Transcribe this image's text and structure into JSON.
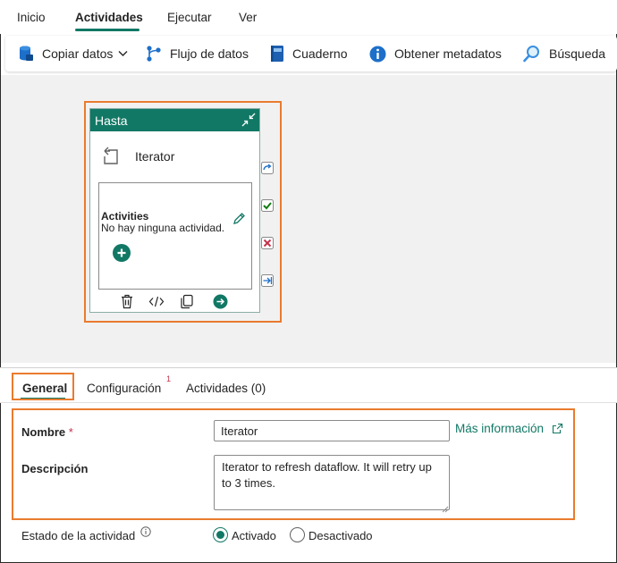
{
  "menu_tabs": [
    {
      "label": "Inicio"
    },
    {
      "label": "Actividades"
    },
    {
      "label": "Ejecutar"
    },
    {
      "label": "Ver"
    }
  ],
  "toolbar": {
    "copy_data": "Copiar datos",
    "dataflow": "Flujo de datos",
    "notebook": "Cuaderno",
    "get_metadata": "Obtener metadatos",
    "lookup": "Búsqueda"
  },
  "activity_card": {
    "header": "Hasta",
    "name": "Iterator",
    "activities_title": "Activities",
    "activities_empty": "No hay ninguna actividad."
  },
  "properties": {
    "tabs": [
      {
        "label": "General"
      },
      {
        "label": "Configuración"
      },
      {
        "label": "Actividades (0)"
      }
    ],
    "config_badge": "1",
    "name_label": "Nombre",
    "required_mark": "*",
    "name_value": "Iterator",
    "more_info": "Más información",
    "description_label": "Descripción",
    "description_value": "Iterator to refresh dataflow. It will retry up to 3 times.",
    "state_label": "Estado de la actividad",
    "state_options": [
      {
        "label": "Activado",
        "selected": true
      },
      {
        "label": "Desactivado",
        "selected": false
      }
    ]
  },
  "colors": {
    "accent": "#117865",
    "highlight": "#e97b2e",
    "error": "#c4314b"
  }
}
